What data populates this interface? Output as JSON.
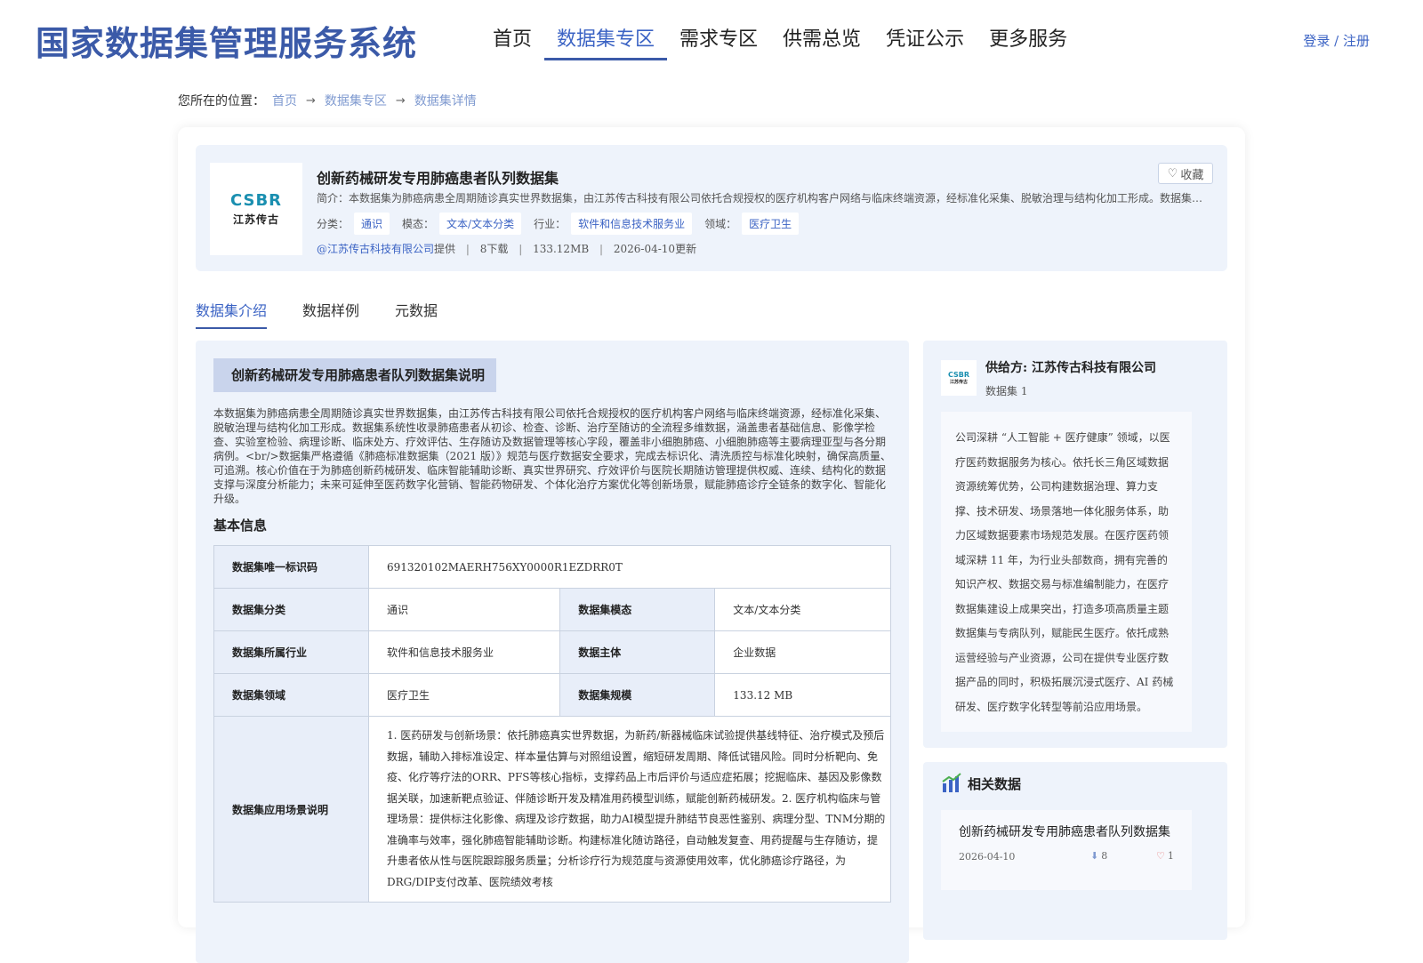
{
  "header": {
    "title": "国家数据集管理服务系统",
    "nav": [
      "首页",
      "数据集专区",
      "需求专区",
      "供需总览",
      "凭证公示",
      "更多服务"
    ],
    "login": "登录 / 注册"
  },
  "breadcrumb": {
    "label": "您所在的位置：",
    "items": [
      "首页",
      "数据集专区",
      "数据集详情"
    ]
  },
  "summary": {
    "logo_text": "CSBR",
    "logo_sub": "江苏传古",
    "title": "创新药械研发专用肺癌患者队列数据集",
    "desc": "简介：本数据集为肺癌病患全周期随诊真实世界数据集，由江苏传古科技有限公司依托合规授权的医疗机构客户网络与临床终端资源，经标准化采集、脱敏治理与结构化加工形成。数据集系统性收录肺癌患者从初诊、检查、诊断、治疗至随访的全流程多维数据",
    "tags": [
      {
        "label": "分类：",
        "value": "通识"
      },
      {
        "label": "模态：",
        "value": "文本/文本分类"
      },
      {
        "label": "行业：",
        "value": "软件和信息技术服务业"
      },
      {
        "label": "领域：",
        "value": "医疗卫生"
      }
    ],
    "provider": "@江苏传古科技有限公司",
    "provider_suffix": "提供",
    "downloads": "8下载",
    "size": "133.12MB",
    "updated": "2026-04-10更新",
    "favorite": "收藏"
  },
  "tabs": [
    "数据集介绍",
    "数据样例",
    "元数据"
  ],
  "intro": {
    "heading": "创新药械研发专用肺癌患者队列数据集说明",
    "text": "本数据集为肺癌病患全周期随诊真实世界数据集，由江苏传古科技有限公司依托合规授权的医疗机构客户网络与临床终端资源，经标准化采集、脱敏治理与结构化加工形成。数据集系统性收录肺癌患者从初诊、检查、诊断、治疗至随访的全流程多维数据，涵盖患者基础信息、影像学检查、实验室检验、病理诊断、临床处方、疗效评估、生存随访及数据管理等核心字段，覆盖非小细胞肺癌、小细胞肺癌等主要病理亚型与各分期病例。<br/>数据集严格遵循《肺癌标准数据集（2021 版）》规范与医疗数据安全要求，完成去标识化、清洗质控与标准化映射，确保高质量、可追溯。核心价值在于为肺癌创新药械研发、临床智能辅助诊断、真实世界研究、疗效评价与医院长期随访管理提供权威、连续、结构化的数据支撑与深度分析能力；未来可延伸至医药数字化营销、智能药物研发、个体化治疗方案优化等创新场景，赋能肺癌诊疗全链条的数字化、智能化升级。",
    "basic_title": "基本信息",
    "table": {
      "id_key": "数据集唯一标识码",
      "id_val": "691320102MAERH756XY0000R1EZDRR0T",
      "rows": [
        [
          "数据集分类",
          "通识",
          "数据集模态",
          "文本/文本分类"
        ],
        [
          "数据集所属行业",
          "软件和信息技术服务业",
          "数据主体",
          "企业数据"
        ],
        [
          "数据集领域",
          "医疗卫生",
          "数据集规模",
          "133.12 MB"
        ]
      ],
      "scene_key": "数据集应用场景说明",
      "scene_val": "1. 医药研发与创新场景：依托肺癌真实世界数据，为新药/新器械临床试验提供基线特征、治疗模式及预后数据，辅助入排标准设定、样本量估算与对照组设置，缩短研发周期、降低试错风险。同时分析靶向、免疫、化疗等疗法的ORR、PFS等核心指标，支撑药品上市后评价与适应症拓展；挖掘临床、基因及影像数据关联，加速新靶点验证、伴随诊断开发及精准用药模型训练，赋能创新药械研发。2. 医疗机构临床与管理场景：提供标注化影像、病理及诊疗数据，助力AI模型提升肺结节良恶性鉴别、病理分型、TNM分期的准确率与效率，强化肺癌智能辅助诊断。构建标准化随访路径，自动触发复查、用药提醒与生存随访，提升患者依从性与医院跟踪服务质量；分析诊疗行为规范度与资源使用效率，优化肺癌诊疗路径，为DRG/DIP支付改革、医院绩效考核"
    }
  },
  "provider_card": {
    "name": "供给方: 江苏传古科技有限公司",
    "count": "数据集 1",
    "intro": "公司深耕 “人工智能 + 医疗健康” 领域，以医疗医药数据服务为核心。依托长三角区域数据资源统筹优势，公司构建数据治理、算力支撑、技术研发、场景落地一体化服务体系，助力区域数据要素市场规范发展。在医疗医药领域深耕 11 年，为行业头部数商，拥有完善的知识产权、数据交易与标准编制能力，在医疗数据集建设上成果突出，打造多项高质量主题数据集与专病队列，赋能民生医疗。依托成熟运营经验与产业资源，公司在提供专业医疗数据产品的同时，积极拓展沉浸式医疗、AI 药械研发、医疗数字化转型等前沿应用场景。"
  },
  "related": {
    "title": "相关数据",
    "items": [
      {
        "title": "创新药械研发专用肺癌患者队列数据集",
        "date": "2026-04-10",
        "downloads": "8",
        "likes": "1"
      }
    ]
  },
  "colors": {
    "accent": "#3b63c4",
    "brand": "#3b5aa8",
    "panel": "#eef3fb"
  }
}
